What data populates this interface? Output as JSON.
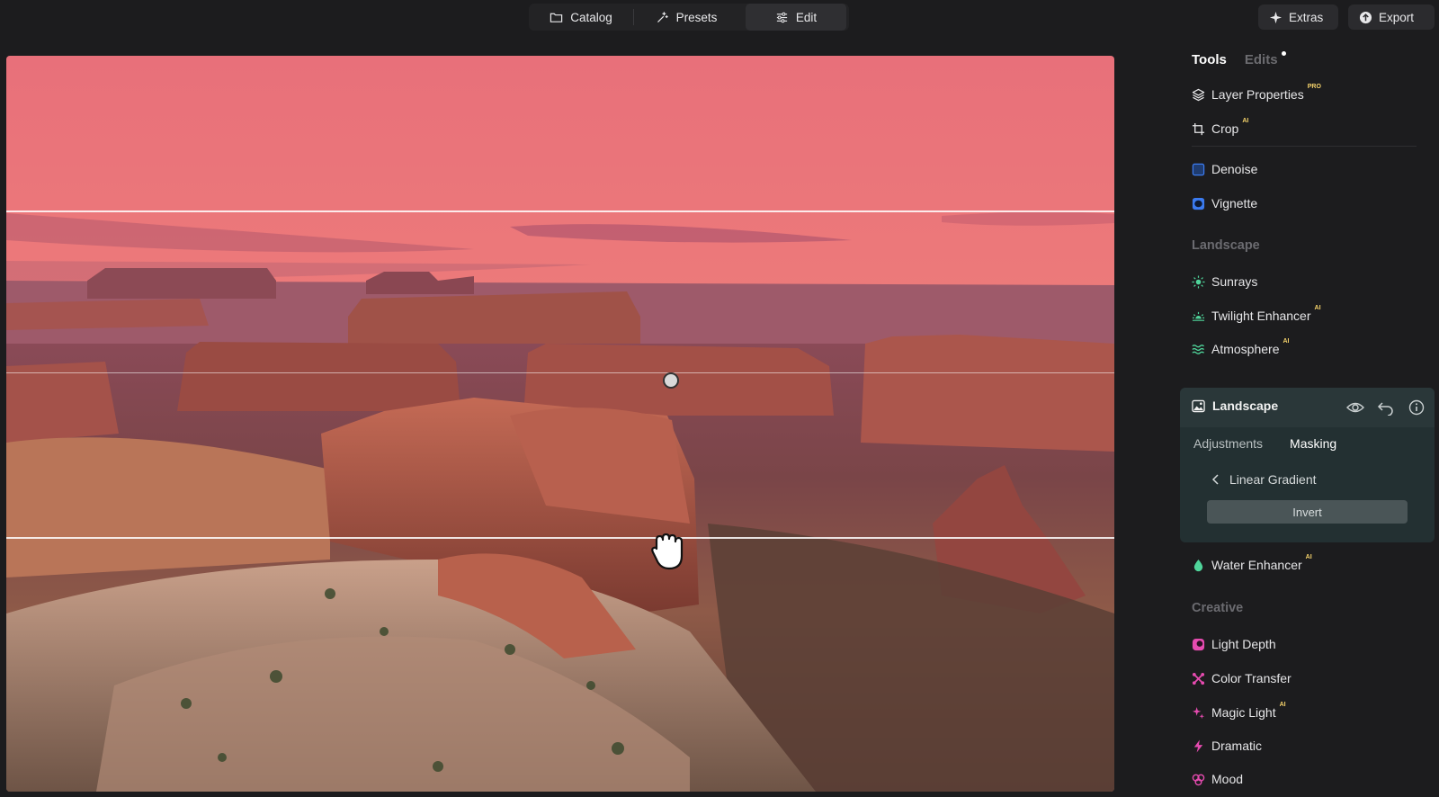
{
  "topbar": {
    "catalog_label": "Catalog",
    "presets_label": "Presets",
    "edit_label": "Edit",
    "extras_label": "Extras",
    "export_label": "Export"
  },
  "panel": {
    "tabs": {
      "tools": "Tools",
      "edits": "Edits"
    },
    "tools_top": [
      {
        "label": "Layer Properties",
        "badge": "PRO",
        "icon": "layers-icon"
      },
      {
        "label": "Crop",
        "badge": "AI",
        "icon": "crop-icon"
      }
    ],
    "tools_basic": [
      {
        "label": "Denoise",
        "icon": "denoise-icon"
      },
      {
        "label": "Vignette",
        "icon": "vignette-icon"
      }
    ],
    "landscape_section": {
      "title": "Landscape",
      "items": [
        {
          "label": "Sunrays",
          "badge": "",
          "icon": "sun-icon"
        },
        {
          "label": "Twilight Enhancer",
          "badge": "AI",
          "icon": "twilight-icon"
        },
        {
          "label": "Atmosphere",
          "badge": "AI",
          "icon": "atmosphere-icon"
        }
      ]
    },
    "landscape_card": {
      "title": "Landscape",
      "subtabs": {
        "adjustments": "Adjustments",
        "masking": "Masking"
      },
      "mask_type": "Linear Gradient",
      "invert_label": "Invert"
    },
    "water_enhancer": {
      "label": "Water Enhancer",
      "badge": "AI"
    },
    "creative_section": {
      "title": "Creative",
      "items": [
        {
          "label": "Light Depth",
          "badge": "",
          "icon": "light-depth-icon"
        },
        {
          "label": "Color Transfer",
          "badge": "",
          "icon": "color-transfer-icon"
        },
        {
          "label": "Magic Light",
          "badge": "AI",
          "icon": "magic-light-icon"
        },
        {
          "label": "Dramatic",
          "badge": "",
          "icon": "lightning-icon"
        },
        {
          "label": "Mood",
          "badge": "",
          "icon": "mood-icon"
        }
      ]
    }
  },
  "colors": {
    "accent_green": "#4fd49a",
    "accent_blue": "#3b7bf0",
    "accent_pink": "#e64bb0",
    "badge_gold": "#f5d36b"
  }
}
